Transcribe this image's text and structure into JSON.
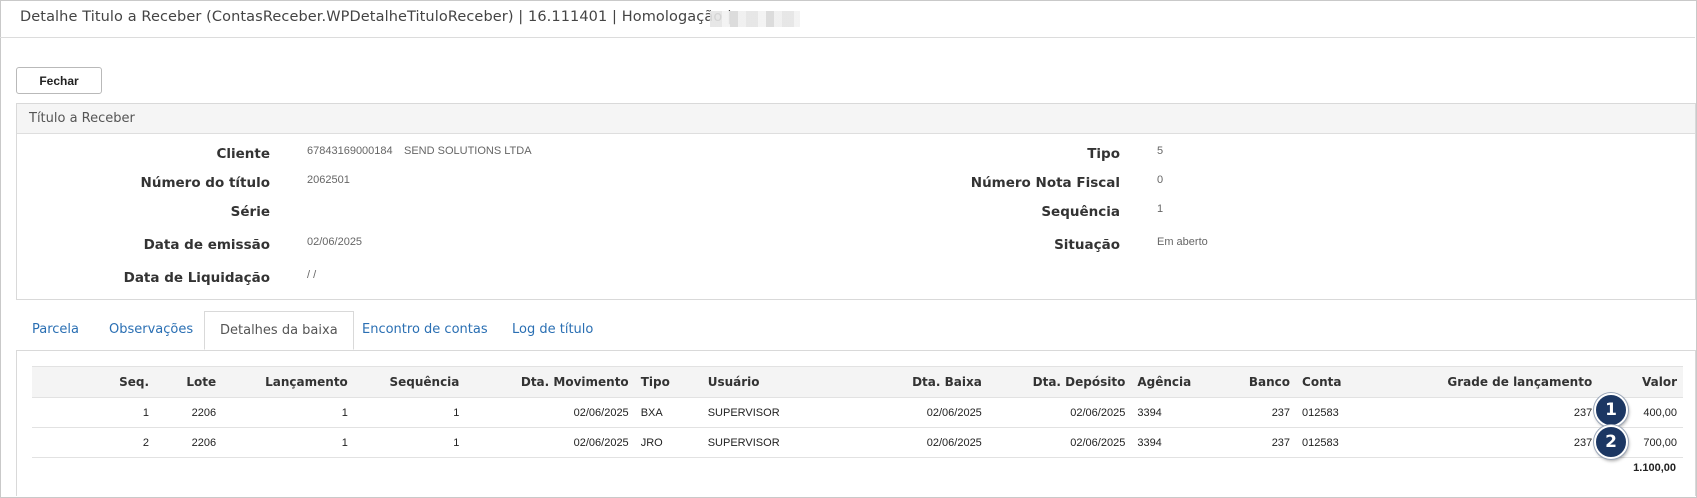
{
  "window": {
    "title": "Detalhe Titulo a Receber (ContasReceber.WPDetalheTituloReceber) | 16.111401 | Homologação |"
  },
  "toolbar": {
    "close_label": "Fechar"
  },
  "panel": {
    "title": "Título a Receber",
    "left_fields": [
      {
        "label": "Cliente",
        "value": "67843169000184",
        "value2": "SEND SOLUTIONS LTDA"
      },
      {
        "label": "Número do título",
        "value": "2062501"
      },
      {
        "label": "Série",
        "value": ""
      },
      {
        "label": "Data de emissão",
        "value": "02/06/2025"
      },
      {
        "label": "Data de Liquidação",
        "value": "/ /"
      }
    ],
    "right_fields": [
      {
        "label": "Tipo",
        "value": "5"
      },
      {
        "label": "Número Nota Fiscal",
        "value": "0"
      },
      {
        "label": "Sequência",
        "value": "1"
      },
      {
        "label": "Situação",
        "value": "Em aberto"
      }
    ]
  },
  "tabs": [
    {
      "label": "Parcela"
    },
    {
      "label": "Observações"
    },
    {
      "label": "Detalhes da baixa",
      "active": true
    },
    {
      "label": "Encontro de contas"
    },
    {
      "label": "Log de título"
    }
  ],
  "grid": {
    "columns": [
      "Seq.",
      "Lote",
      "Lançamento",
      "Sequência",
      "Dta. Movimento",
      "Tipo",
      "Usuário",
      "Dta. Baixa",
      "Dta. Depósito",
      "Agência",
      "Banco",
      "Conta",
      "Grade de lançamento",
      "Valor"
    ],
    "rows": [
      [
        "1",
        "2206",
        "1",
        "1",
        "02/06/2025",
        "BXA",
        "SUPERVISOR",
        "02/06/2025",
        "02/06/2025",
        "3394",
        "237",
        "012583",
        "237",
        "400,00"
      ],
      [
        "2",
        "2206",
        "1",
        "1",
        "02/06/2025",
        "JRO",
        "SUPERVISOR",
        "02/06/2025",
        "02/06/2025",
        "3394",
        "237",
        "012583",
        "237",
        "700,00"
      ]
    ],
    "total": "1.100,00"
  },
  "markers": [
    "1",
    "2"
  ],
  "colors": {
    "link": "#2a6fb3",
    "marker": "#1c3763"
  }
}
